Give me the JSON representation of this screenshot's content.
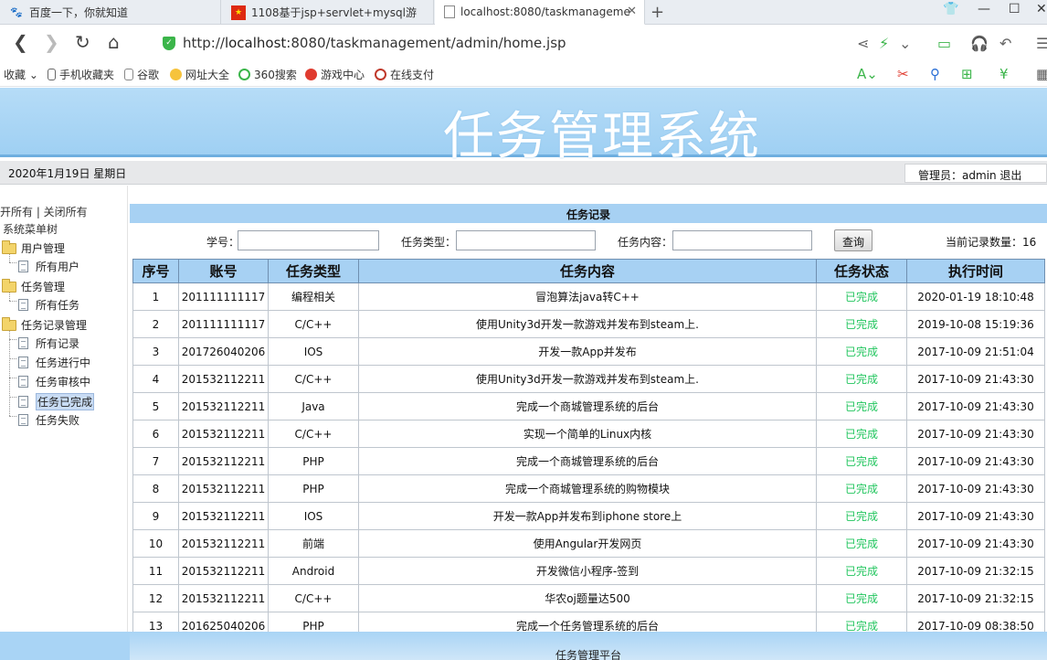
{
  "browser": {
    "tabs": [
      {
        "title": "百度一下，你就知道",
        "active": false
      },
      {
        "title": "1108基于jsp+servlet+mysql游",
        "active": false
      },
      {
        "title": "localhost:8080/taskmanageme",
        "active": true
      }
    ],
    "new_tab_glyph": "+",
    "url_prefix": "http://",
    "url_host": "localhost",
    "url_rest": ":8080/taskmanagement/admin/home.jsp",
    "bookmarks": [
      "收藏",
      "手机收藏夹",
      "谷歌",
      "网址大全",
      "360搜索",
      "游戏中心",
      "在线支付"
    ]
  },
  "header": {
    "title": "任务管理系统",
    "date": "2020年1月19日 星期日",
    "admin": "管理员：admin 退出"
  },
  "sidebar": {
    "toggle": "开所有 | 关闭所有",
    "root": "系统菜单树",
    "groups": [
      {
        "label": "用户管理",
        "items": [
          "所有用户"
        ]
      },
      {
        "label": "任务管理",
        "items": [
          "所有任务"
        ]
      },
      {
        "label": "任务记录管理",
        "items": [
          "所有记录",
          "任务进行中",
          "任务审核中",
          "任务已完成",
          "任务失败"
        ]
      }
    ],
    "selected": "任务已完成"
  },
  "main": {
    "panel_title": "任务记录",
    "search": {
      "student_label": "学号：",
      "type_label": "任务类型：",
      "content_label": "任务内容：",
      "button": "查询",
      "count": "当前记录数量：16"
    },
    "columns": [
      "序号",
      "账号",
      "任务类型",
      "任务内容",
      "任务状态",
      "执行时间"
    ],
    "rows": [
      [
        "1",
        "201111111117",
        "编程相关",
        "冒泡算法java转C++",
        "已完成",
        "2020-01-19 18:10:48"
      ],
      [
        "2",
        "201111111117",
        "C/C++",
        "使用Unity3d开发一款游戏并发布到steam上.",
        "已完成",
        "2019-10-08 15:19:36"
      ],
      [
        "3",
        "201726040206",
        "IOS",
        "开发一款App并发布",
        "已完成",
        "2017-10-09 21:51:04"
      ],
      [
        "4",
        "201532112211",
        "C/C++",
        "使用Unity3d开发一款游戏并发布到steam上.",
        "已完成",
        "2017-10-09 21:43:30"
      ],
      [
        "5",
        "201532112211",
        "Java",
        "完成一个商城管理系统的后台",
        "已完成",
        "2017-10-09 21:43:30"
      ],
      [
        "6",
        "201532112211",
        "C/C++",
        "实现一个简单的Linux内核",
        "已完成",
        "2017-10-09 21:43:30"
      ],
      [
        "7",
        "201532112211",
        "PHP",
        "完成一个商城管理系统的后台",
        "已完成",
        "2017-10-09 21:43:30"
      ],
      [
        "8",
        "201532112211",
        "PHP",
        "完成一个商城管理系统的购物模块",
        "已完成",
        "2017-10-09 21:43:30"
      ],
      [
        "9",
        "201532112211",
        "IOS",
        "开发一款App并发布到iphone store上",
        "已完成",
        "2017-10-09 21:43:30"
      ],
      [
        "10",
        "201532112211",
        "前端",
        "使用Angular开发网页",
        "已完成",
        "2017-10-09 21:43:30"
      ],
      [
        "11",
        "201532112211",
        "Android",
        "开发微信小程序-签到",
        "已完成",
        "2017-10-09 21:32:15"
      ],
      [
        "12",
        "201532112211",
        "C/C++",
        "华农oj题量达500",
        "已完成",
        "2017-10-09 21:32:15"
      ],
      [
        "13",
        "201625040206",
        "PHP",
        "完成一个任务管理系统的后台",
        "已完成",
        "2017-10-09 08:38:50"
      ]
    ],
    "status_color": "#22c55e"
  },
  "footer": {
    "text": "任务管理平台"
  },
  "colors": {
    "banner": "#a7d1f3",
    "header_row": "#a7d1f3"
  }
}
